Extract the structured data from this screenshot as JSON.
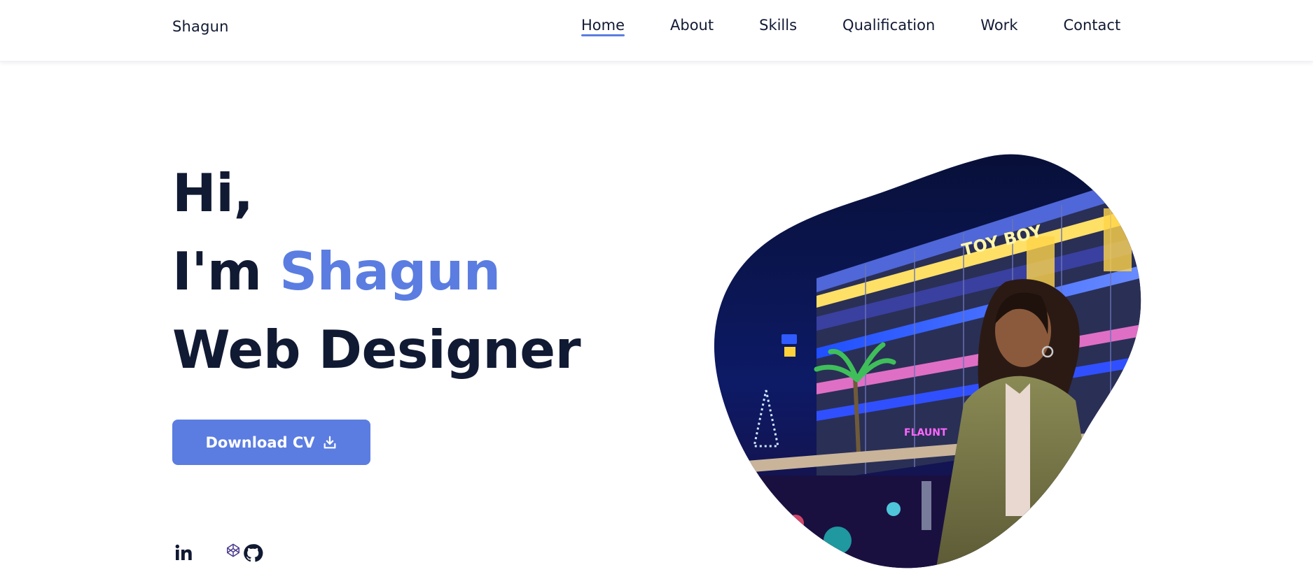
{
  "header": {
    "logo": "Shagun",
    "nav": [
      {
        "label": "Home",
        "active": true
      },
      {
        "label": "About",
        "active": false
      },
      {
        "label": "Skills",
        "active": false
      },
      {
        "label": "Qualification",
        "active": false
      },
      {
        "label": "Work",
        "active": false
      },
      {
        "label": "Contact",
        "active": false
      }
    ]
  },
  "hero": {
    "line1": "Hi,",
    "line2_prefix": "I'm ",
    "line2_name": "Shagun",
    "line3": "Web Designer",
    "button_label": "Download CV",
    "button_icon": "download-icon",
    "photo_signs": {
      "sign1": "TOY BOY",
      "sign2": "FLAUNT"
    }
  },
  "socials": [
    {
      "name": "linkedin-icon"
    },
    {
      "name": "codepen-icon"
    },
    {
      "name": "github-icon"
    }
  ],
  "colors": {
    "accent": "#5b7de1",
    "text": "#111a33",
    "background": "#ffffff"
  }
}
